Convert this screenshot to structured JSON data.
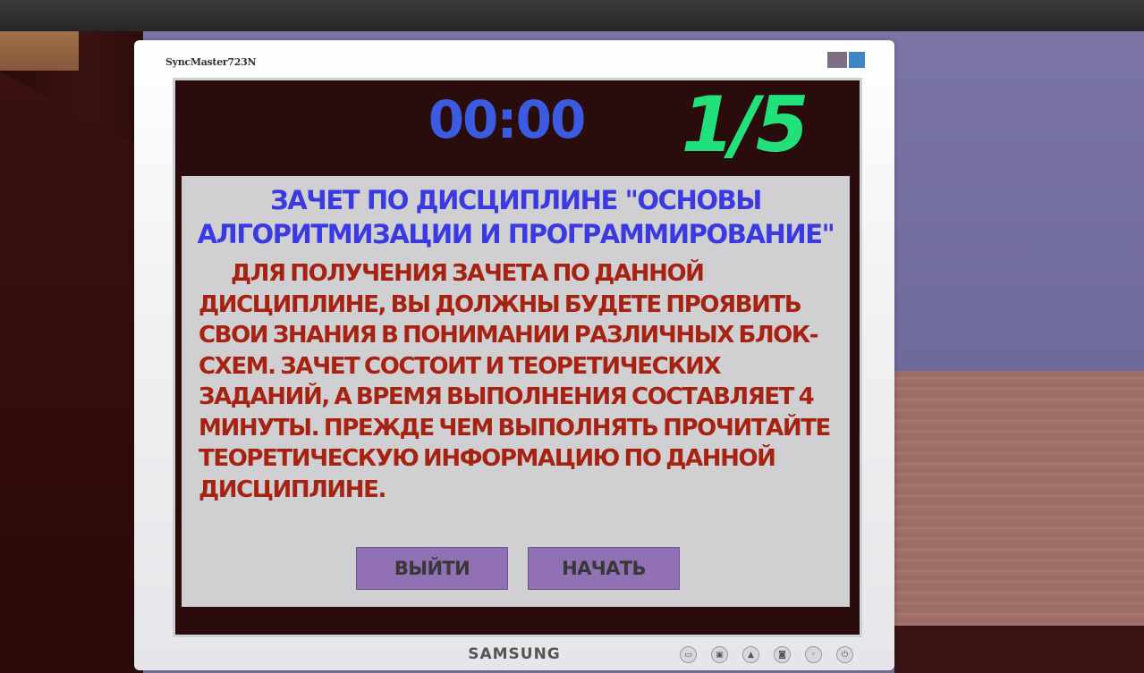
{
  "monitor": {
    "brand_top": "SyncMaster723N",
    "brand_bottom": "SAMSUNG",
    "controls": [
      {
        "icon": "menu-icon",
        "glyph": "▭"
      },
      {
        "icon": "source-icon",
        "glyph": "▣"
      },
      {
        "icon": "brightness-icon",
        "glyph": "▲"
      },
      {
        "icon": "auto-icon",
        "glyph": "◙"
      },
      {
        "icon": "input-icon",
        "glyph": "◦"
      },
      {
        "icon": "power-icon",
        "glyph": "⏻"
      }
    ]
  },
  "hud": {
    "timer": "00:00",
    "counter": "1/5"
  },
  "panel": {
    "title": "ЗАЧЕТ ПО ДИСЦИПЛИНЕ \"ОСНОВЫ АЛГОРИТМИЗАЦИИ И ПРОГРАММИРОВАНИЕ\"",
    "body": "ДЛЯ ПОЛУЧЕНИЯ ЗАЧЕТА ПО ДАННОЙ ДИСЦИПЛИНЕ, ВЫ ДОЛЖНЫ БУДЕТЕ ПРОЯВИТЬ СВОИ ЗНАНИЯ В ПОНИМАНИИ РАЗЛИЧНЫХ БЛОК-СХЕМ. ЗАЧЕТ СОСТОИТ И ТЕОРЕТИЧЕСКИХ ЗАДАНИЙ, А ВРЕМЯ ВЫПОЛНЕНИЯ СОСТАВЛЯЕТ 4 МИНУТЫ. ПРЕЖДЕ ЧЕМ ВЫПОЛНЯТЬ ПРОЧИТАЙТЕ ТЕОРЕТИЧЕСКУЮ ИНФОРМАЦИЮ ПО ДАННОЙ ДИСЦИПЛИНЕ.",
    "exit_label": "ВЫЙТИ",
    "start_label": "НАЧАТЬ"
  },
  "colors": {
    "timer": "#3b5ce0",
    "counter": "#22e07a",
    "title": "#3a3ae0",
    "body": "#a62212",
    "button": "#9170b4"
  }
}
